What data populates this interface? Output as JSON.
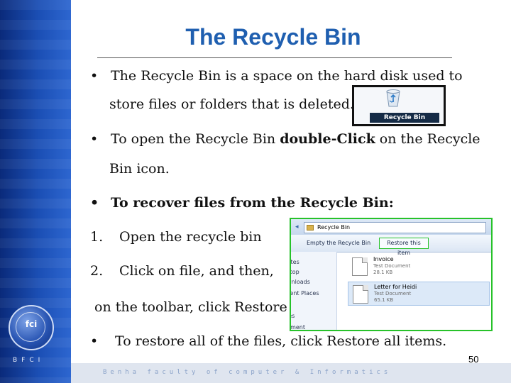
{
  "slide": {
    "title": "The Recycle Bin",
    "bullets": [
      {
        "marker": "•",
        "line1": "The Recycle Bin is a space on the hard disk used to",
        "line2": "store files or folders that is deleted."
      },
      {
        "marker": "•",
        "text_before": "To open the Recycle Bin ",
        "bold_text": "double-Click",
        "text_after": " on the Recycle",
        "line2": "Bin icon."
      },
      {
        "marker": "•",
        "text": "To recover files from the Recycle Bin:"
      }
    ],
    "steps": [
      {
        "number": "1.",
        "text": "Open the recycle bin"
      },
      {
        "number": "2.",
        "text": "Click on file, and then,",
        "continuation": "on the toolbar, click Restore"
      }
    ],
    "last_bullet": {
      "marker": "•",
      "text": "To restore all of the files, click Restore all items."
    },
    "page_number": "50"
  },
  "recycle_bin_icon": {
    "label": "Recycle Bin",
    "icon": "recycle-bin-icon"
  },
  "explorer": {
    "address": "Recycle Bin",
    "toolbar": {
      "empty_label": "Empty the Recycle Bin",
      "restore_label": "Restore this item"
    },
    "nav_items": [
      "rites",
      "ktop",
      "wnloads",
      "cent Places",
      "ies",
      "ument"
    ],
    "files": [
      {
        "name": "Invoice",
        "type": "Test Document",
        "size": "28.1 KB",
        "selected": false
      },
      {
        "name": "Letter for Heidi",
        "type": "Test Document",
        "size": "65.1 KB",
        "selected": true
      }
    ]
  },
  "branding": {
    "logo_text": "fci",
    "short_name": "BFCI",
    "footer": "Benha faculty of computer & Informatics"
  },
  "colors": {
    "title": "#1f5fb0",
    "sidebar": "#1b4fb5",
    "highlight": "#27c22a"
  }
}
